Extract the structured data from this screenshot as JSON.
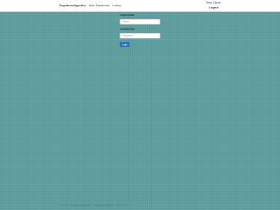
{
  "navbar": {
    "brand": "RegisteredAgentInc",
    "links": [
      {
        "label": "Main Dashboard"
      },
      {
        "label": "Lookup"
      }
    ],
    "time_clock": "Time Clock",
    "logout": "Logout"
  },
  "login": {
    "username_label": "USERNAME",
    "username_placeholder": "Name",
    "password_label": "PASSWORD",
    "password_placeholder": "Password",
    "login_button": "Login"
  },
  "footer": {
    "text": "© 2024 - RegisteredAgentInc · Corporate Support · Version 2.0"
  },
  "colors": {
    "background": "#5e9e9e",
    "accent": "#2a6fb8",
    "navbar": "#ffffff"
  }
}
